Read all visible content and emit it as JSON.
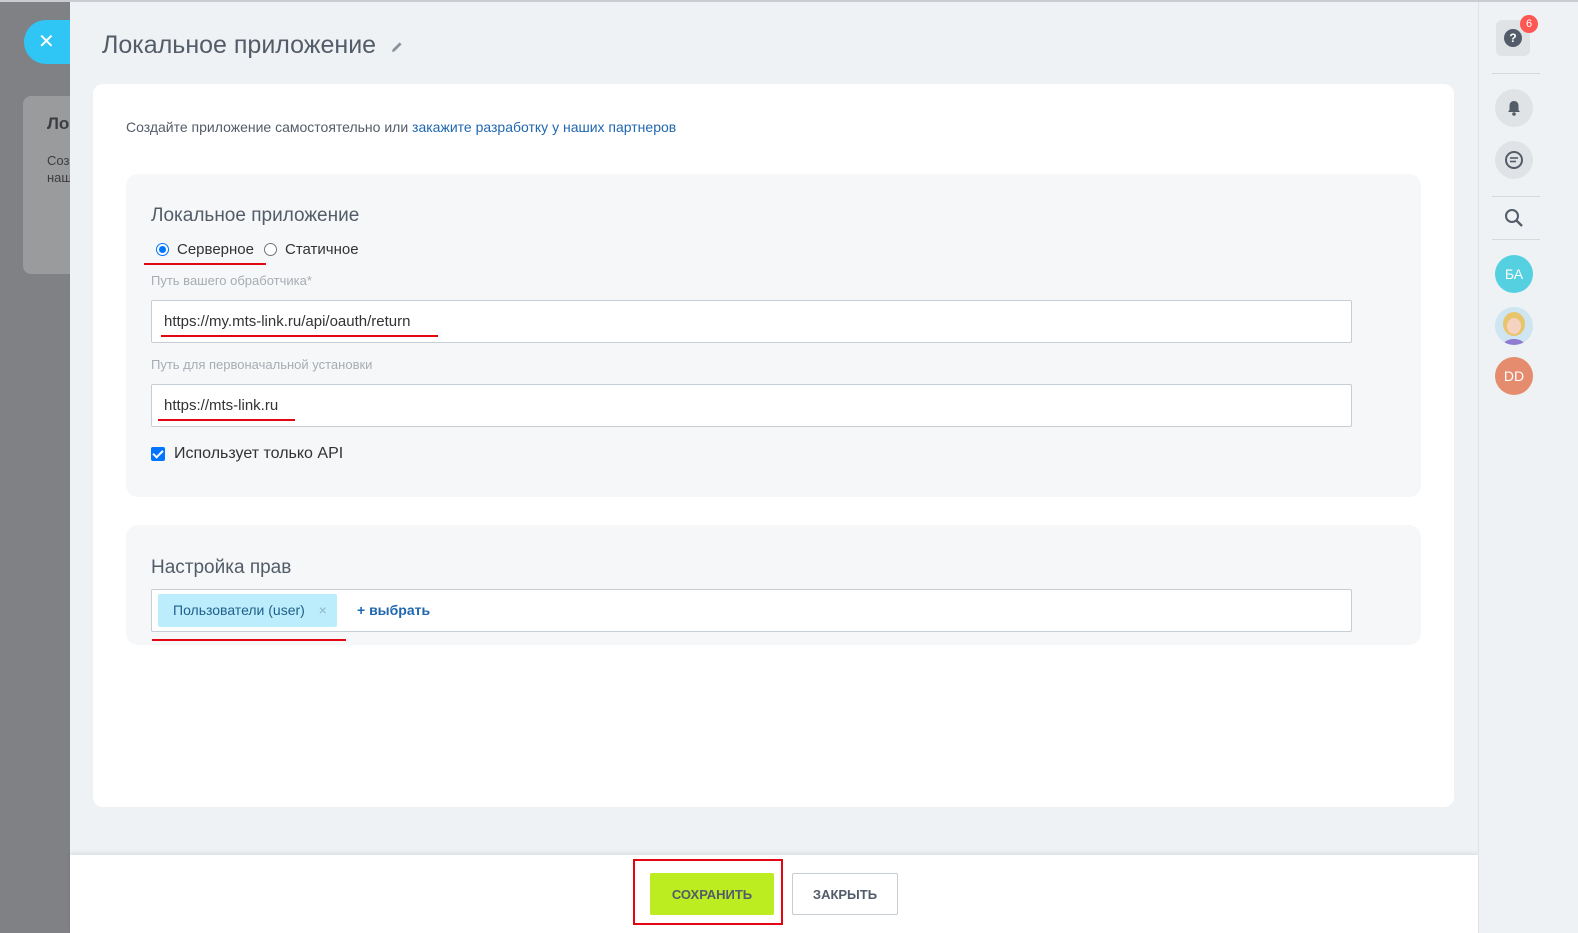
{
  "background_page": {
    "card_title": "Ло",
    "card_text": "Соз\nнаш"
  },
  "close_slider_icon": "close-icon",
  "slider": {
    "title": "Локальное приложение",
    "title_edit_icon": "pencil-icon"
  },
  "intro": {
    "text": "Создайте приложение самостоятельно или ",
    "link": "закажите разработку у наших партнеров"
  },
  "app_section": {
    "title": "Локальное приложение",
    "radio_options": [
      {
        "label": "Серверное",
        "checked": true
      },
      {
        "label": "Статичное",
        "checked": false
      }
    ],
    "handler_label": "Путь вашего обработчика*",
    "handler_value": "https://my.mts-link.ru/api/oauth/return",
    "install_label": "Путь для первоначальной установки",
    "install_value": "https://mts-link.ru",
    "api_only_label": "Использует только API",
    "api_only_checked": true
  },
  "permissions_section": {
    "title": "Настройка прав",
    "tags": [
      {
        "label": "Пользователи (user)"
      }
    ],
    "tag_remove": "×",
    "add_link": "+ выбрать"
  },
  "footer": {
    "save_label": "СОХРАНИТЬ",
    "close_label": "ЗАКРЫТЬ"
  },
  "right_bar": {
    "help_icon": "help-icon",
    "help_badge": "6",
    "bell_icon": "bell-icon",
    "chat_icon": "chat-icon",
    "search_icon": "search-icon",
    "avatars": [
      {
        "initials": "БА",
        "color": "#55d0e0"
      },
      {
        "initials": "",
        "image": "user-photo"
      },
      {
        "initials": "DD",
        "color": "#e58c6e"
      }
    ]
  },
  "colors": {
    "accent_link": "#2067b0",
    "save_button": "#bbed21",
    "highlight_red": "#e30613",
    "tag_bg": "#bcedfc"
  }
}
